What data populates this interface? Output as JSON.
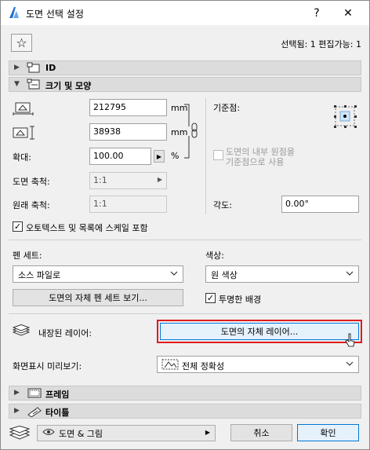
{
  "window": {
    "title": "도면 선택 설정",
    "help_label": "?",
    "close_label": "✕"
  },
  "header": {
    "selected_info": "선택됨: 1 편집가능: 1"
  },
  "sections": {
    "id": "ID",
    "size_shape": "크기 및 모양",
    "frame": "프레임",
    "title": "타이틀"
  },
  "size": {
    "width_value": "212795",
    "height_value": "38938",
    "unit": "mm",
    "scale_label": "확대:",
    "scale_value": "100.00",
    "percent": "%",
    "drawing_scale_label": "도면 축척:",
    "drawing_scale_value": "1:1",
    "original_scale_label": "원래 축척:",
    "original_scale_value": "1:1",
    "anchor_label": "기준점:",
    "use_origin_label": "도면의 내부 원점을\n기준점으로 사용",
    "angle_label": "각도:",
    "angle_value": "0.00°",
    "autotext_label": "오토텍스트 및 목록에 스케일 포함"
  },
  "pen": {
    "pen_set_label": "펜 세트:",
    "pen_set_value": "소스 파일로",
    "color_label": "색상:",
    "color_value": "원 색상",
    "view_pen_set_button": "도면의 자체 펜 세트 보기...",
    "transparent_label": "투명한 배경"
  },
  "layers": {
    "label": "내장된 레이어:",
    "button": "도면의 자체 레이어..."
  },
  "preview": {
    "label": "화면표시 미리보기:",
    "value": "전체 정확성"
  },
  "footer": {
    "layer_value": "도면 & 그림",
    "cancel": "취소",
    "ok": "확인"
  },
  "colors": {
    "highlight": "#e01b1b",
    "accent": "#0078d7"
  }
}
